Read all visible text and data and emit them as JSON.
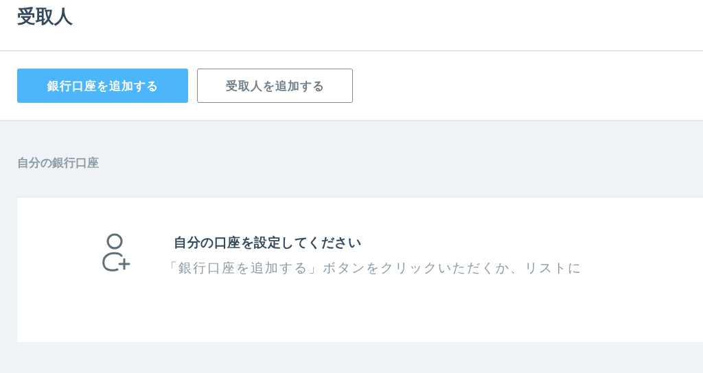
{
  "page": {
    "title": "受取人"
  },
  "toolbar": {
    "buttons": [
      {
        "label": "銀行口座を追加する",
        "kind": "primary"
      },
      {
        "label": "受取人を追加する",
        "kind": "outline"
      }
    ]
  },
  "section": {
    "label": "自分の銀行口座"
  },
  "empty_state": {
    "title": "自分の口座を設定してください",
    "message": "「銀行口座を追加する」ボタンをクリックいただくか、リストに"
  }
}
